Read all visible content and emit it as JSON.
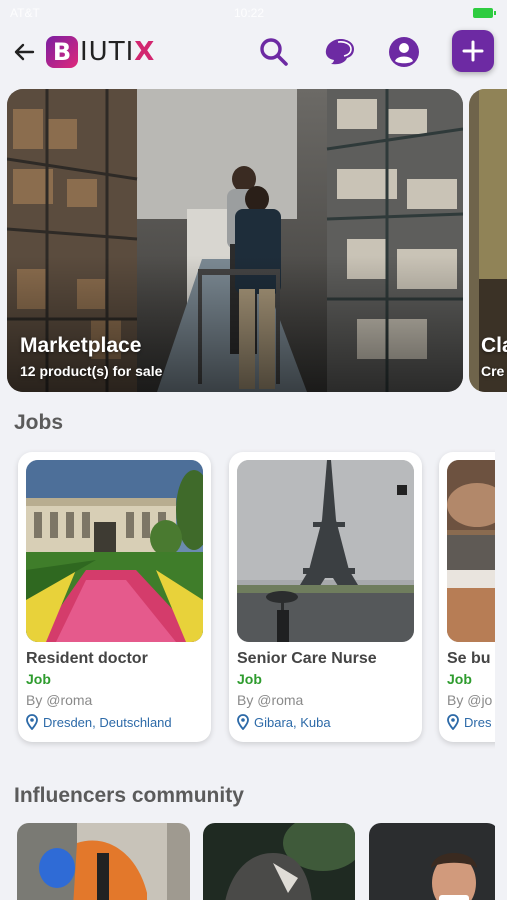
{
  "status_bar": {
    "carrier": "AT&T",
    "time": "10:22"
  },
  "header": {
    "logo_letter": "B",
    "logo_text": "IUTI",
    "logo_accent": "X",
    "brand_color": "#6d2aa3",
    "icons": [
      "back-arrow-icon",
      "search-icon",
      "chat-icon",
      "account-icon",
      "plus-icon"
    ]
  },
  "hero_cards": [
    {
      "title": "Marketplace",
      "subtitle": "12 product(s) for sale"
    },
    {
      "title": "Cla",
      "subtitle": "Cre"
    }
  ],
  "sections": {
    "jobs_title": "Jobs",
    "influencers_title": "Influencers community"
  },
  "jobs": [
    {
      "title": "Resident doctor",
      "type": "Job",
      "author": "By @roma",
      "location": "Dresden, Deutschland"
    },
    {
      "title": "Senior Care Nurse",
      "type": "Job",
      "author": "By @roma",
      "location": "Gibara, Kuba"
    },
    {
      "title": "Se bu",
      "type": "Job",
      "author": "By @jo",
      "location": "Dres"
    }
  ],
  "colors": {
    "job_type": "#2f9c2f",
    "location": "#2d6aa8",
    "background": "#f1f2f6"
  }
}
